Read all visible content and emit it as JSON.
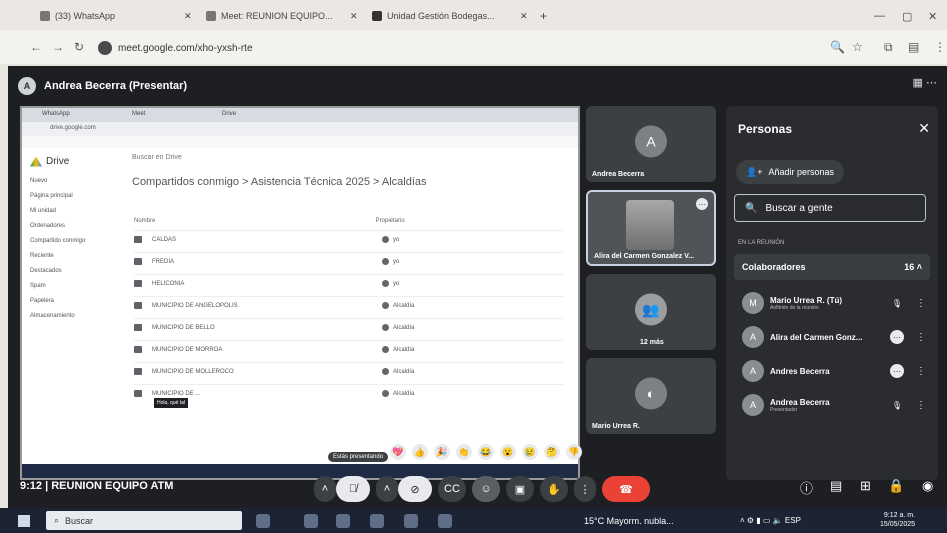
{
  "browser": {
    "tabs": [
      {
        "label": "(33) WhatsApp"
      },
      {
        "label": "Meet: REUNION EQUIPO..."
      },
      {
        "label": "Unidad Gestión Bodegas..."
      }
    ],
    "url": "meet.google.com/xho-yxsh-rte",
    "window_controls": [
      "—",
      "▢",
      "✕"
    ]
  },
  "meet": {
    "presenter_banner": "Andrea Becerra (Presentar)",
    "presenter_initial": "A",
    "meeting_time": "9:12",
    "meeting_name": "REUNION EQUIPO ATM"
  },
  "shared_screen": {
    "drive_title": "Drive",
    "search_placeholder": "Buscar en Drive",
    "breadcrumb": "Compartidos conmigo  >  Asistencia Técnica 2025  >  Alcaldías",
    "header_name": "Nombre",
    "header_owner": "Propietario",
    "sidebar": [
      "Nuevo",
      "Página principal",
      "Mi unidad",
      "Ordenadores",
      "Compartido conmigo",
      "Reciente",
      "Destacados",
      "Spam",
      "Papelera",
      "Almacenamiento"
    ],
    "files": [
      {
        "name": "CALDAS",
        "owner": "yo"
      },
      {
        "name": "FREDIA",
        "owner": "yo"
      },
      {
        "name": "HELICONIA",
        "owner": "yo"
      },
      {
        "name": "MUNICIPIO DE ANGELOPOLIS",
        "owner": "Alcaldía"
      },
      {
        "name": "MUNICIPIO DE BELLO",
        "owner": "Alcaldía"
      },
      {
        "name": "MUNICIPIO DE MORROA",
        "owner": "Alcaldía"
      },
      {
        "name": "MUNICIPIO DE MOLLEROCO",
        "owner": "Alcaldía"
      },
      {
        "name": "MUNICIPIO DE ...",
        "owner": "Alcaldía"
      }
    ],
    "tooltip": "Hola, qué tal",
    "share_badge": "Estás presentando"
  },
  "tiles": [
    {
      "name": "Andrea Becerra",
      "initial": "A"
    },
    {
      "name": "Alira del Carmen Gonzalez V...",
      "initial": ""
    },
    {
      "name": "12 más",
      "initial": ""
    },
    {
      "name": "Mario Urrea R.",
      "initial": ""
    }
  ],
  "people_panel": {
    "title": "Personas",
    "add_people": "Añadir personas",
    "search_placeholder": "Buscar a gente",
    "in_meeting_label": "EN LA REUNIÓN",
    "group_label": "Colaboradores",
    "group_count": "16",
    "participants": [
      {
        "name": "Mario Urrea R. (Tú)",
        "sub": "Anfitrión de la reunión",
        "initial": "M"
      },
      {
        "name": "Alira del Carmen Gonz...",
        "sub": "",
        "initial": "A"
      },
      {
        "name": "Andres Becerra",
        "sub": "",
        "initial": "A"
      },
      {
        "name": "Andrea Becerra",
        "sub": "Presentador",
        "initial": "A"
      }
    ]
  },
  "reactions": [
    "💖",
    "👍",
    "🎉",
    "👏",
    "😂",
    "😮",
    "😢",
    "🤔",
    "👎"
  ],
  "taskbar": {
    "search_placeholder": "Buscar",
    "weather": "15°C  Mayorm. nubla...",
    "lang": "ESP",
    "time": "9:12 a. m.",
    "date": "15/05/2025"
  }
}
